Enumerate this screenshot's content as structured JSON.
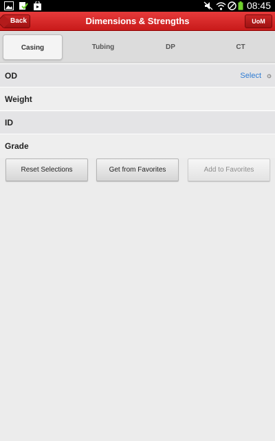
{
  "statusbar": {
    "time": "08:45",
    "left_icons": [
      "image-icon",
      "download-done-icon",
      "shopping-bag-icon"
    ],
    "right_icons": [
      "mute-icon",
      "wifi-icon",
      "blocked-icon",
      "battery-icon"
    ]
  },
  "header": {
    "title": "Dimensions & Strengths",
    "back_label": "Back",
    "uom_label": "UoM"
  },
  "tabs": [
    {
      "label": "Casing",
      "active": true
    },
    {
      "label": "Tubing",
      "active": false
    },
    {
      "label": "DP",
      "active": false
    },
    {
      "label": "CT",
      "active": false
    }
  ],
  "fields": [
    {
      "label": "OD",
      "value": "Select"
    },
    {
      "label": "Weight",
      "value": ""
    },
    {
      "label": "ID",
      "value": ""
    },
    {
      "label": "Grade",
      "value": ""
    }
  ],
  "buttons": {
    "reset": "Reset Selections",
    "get_favorites": "Get from Favorites",
    "add_favorites": "Add to Favorites"
  },
  "colors": {
    "accent": "#d42424",
    "link": "#2e7bd3"
  }
}
